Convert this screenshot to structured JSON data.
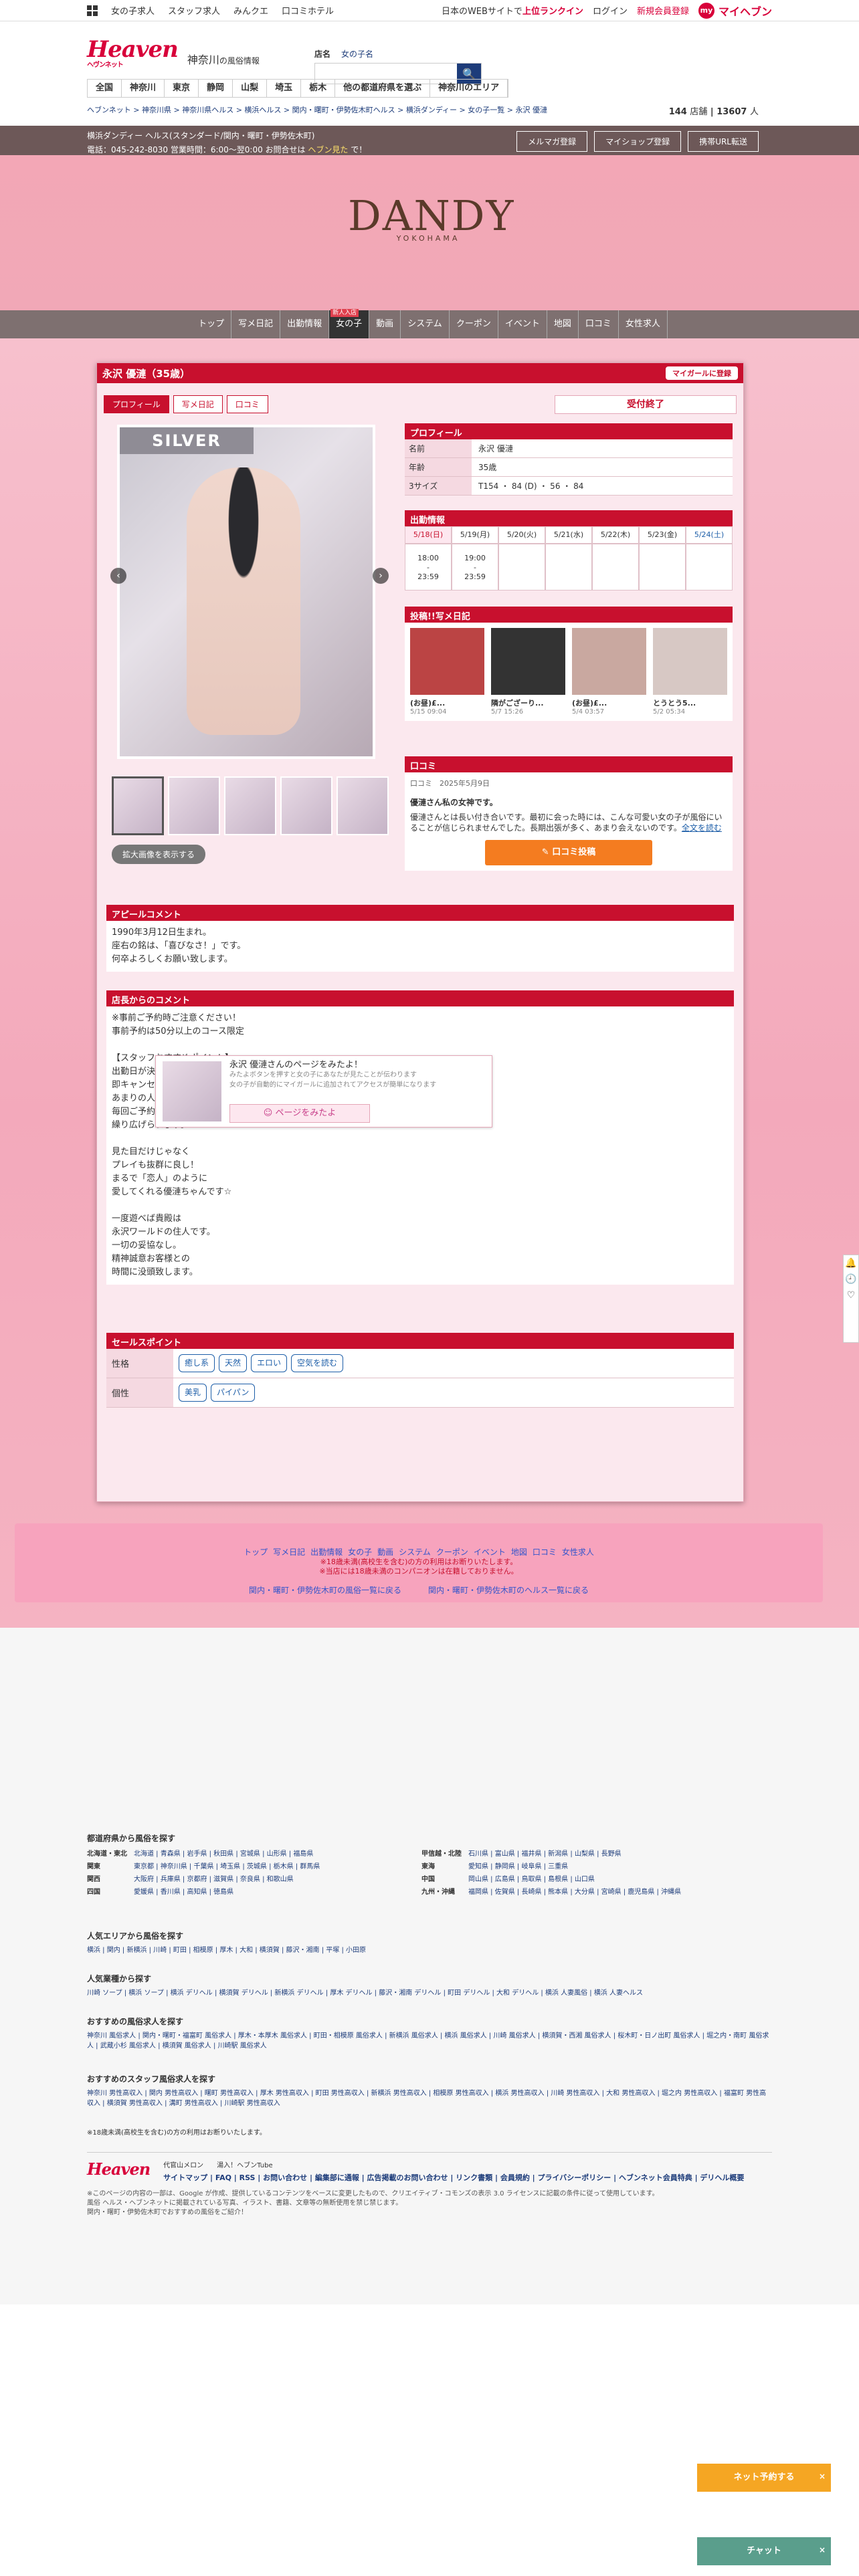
{
  "topbar": {
    "left": [
      "女の子求人",
      "スタッフ求人",
      "みんクエ",
      "口コミホテル"
    ],
    "right_text": "日本のWEBサイトで",
    "right_hl": "上位ランクイン",
    "login": "ログイン",
    "register": "新規会員登録",
    "myheaven": "マイヘブン"
  },
  "header": {
    "logo": "Heaven",
    "logo_sub": "ヘヴンネット",
    "region": "神奈川",
    "region_sub": "の風俗情報",
    "search_label": "店名",
    "search_ph": "女の子名"
  },
  "areanav": [
    "全国",
    "神奈川",
    "東京",
    "静岡",
    "山梨",
    "埼玉",
    "栃木",
    "他の都道府県を選ぶ",
    "神奈川のエリア"
  ],
  "breadcrumb": "ヘブンネット > 神奈川県 > 神奈川県ヘルス > 横浜ヘルス > 関内・曙町・伊勢佐木町ヘルス > 横浜ダンディー > 女の子一覧 > 永沢 優漣",
  "count": {
    "a": "144",
    "a_unit": "店舗",
    "b": "13607",
    "b_unit": "人"
  },
  "shopbar": {
    "line1": "横浜ダンディー ヘルス(スタンダード/関内・曙町・伊勢佐木町)",
    "line2": "電話：045-242-8030 営業時間：6:00〜翌0:00 お問合せは",
    "line2_hl": "ヘブン見た",
    "line2_end": "で！",
    "btn1": "メルマガ登録",
    "btn2": "マイショップ登録",
    "btn3": "携帯URL転送"
  },
  "shop_logo": {
    "mark": "DANDY",
    "sub": "YOKOHAMA"
  },
  "mainnav": [
    "トップ",
    "写メ日記",
    "出勤情報",
    "女の子",
    "動画",
    "システム",
    "クーポン",
    "イベント",
    "地図",
    "口コミ",
    "女性求人"
  ],
  "mainnav_badge": "新人入店",
  "profile": {
    "name": "永沢 優漣（35歳）",
    "mypage": "マイガールに登録",
    "tabs": [
      "プロフィール",
      "写メ日記",
      "口コミ"
    ],
    "status": "受付終了",
    "silver": "SILVER",
    "zoom": "拡大画像を表示する"
  },
  "prof_section": {
    "title": "プロフィール",
    "rows": [
      {
        "k": "名前",
        "v": "永沢 優漣"
      },
      {
        "k": "年齢",
        "v": "35歳"
      },
      {
        "k": "3サイズ",
        "v": "T154 ・ 84 (D) ・ 56 ・ 84"
      }
    ]
  },
  "sched": {
    "title": "出勤情報",
    "days": [
      "5/18(日)",
      "5/19(月)",
      "5/20(火)",
      "5/21(水)",
      "5/22(木)",
      "5/23(金)",
      "5/24(土)"
    ],
    "times": [
      "18:00\n-\n23:59",
      "19:00\n-\n23:59",
      "",
      "",
      "",
      "",
      ""
    ]
  },
  "diary": {
    "title": "投稿!!写メ日記",
    "items": [
      {
        "t": "(お昼)£...",
        "d": "5/15 09:04"
      },
      {
        "t": "隣がござーり...",
        "d": "5/7 15:26"
      },
      {
        "t": "(お昼)£...",
        "d": "5/4 03:57"
      },
      {
        "t": "とうとう5...",
        "d": "5/2 05:34"
      }
    ]
  },
  "review": {
    "title": "口コミ",
    "label": "口コミ",
    "date": "2025年5月9日",
    "heading": "優漣さん私の女神です。",
    "body": "優漣さんとは長い付き合いです。最初に会った時には、こんな可愛い女の子が風俗にいることが信じられませんでした。長期出張が多く、あまり会えないのです。",
    "more": "全文を読む",
    "btn": "✎ 口コミ投稿"
  },
  "appeal": {
    "title": "アピールコメント",
    "lines": [
      "1990年3月12日生まれ。",
      "座右の銘は、「喜びなさ！」です。",
      "何卒よろしくお願い致します。"
    ]
  },
  "manager": {
    "title": "店長からのコメント",
    "lines": [
      "※事前ご予約時ご注意ください！",
      "事前予約は50分以上のコース限定",
      "",
      "【スタッフおすすめポイント】",
      "出勤日が決まれば",
      "即キャンセル待ちになる女の子♪",
      "あまりの人気ぶりに",
      "毎回ご予約争奪戦が",
      "繰り広げられます。",
      "",
      "見た目だけじゃなく",
      "プレイも抜群に良し！",
      "まるで「恋人」のように",
      "愛してくれる優漣ちゃんです☆",
      "",
      "一度遊べば貴殿は",
      "永沢ワールドの住人です。",
      "一切の妥協なし。",
      "精神誠意お客様との",
      "時間に没頭致します。"
    ]
  },
  "sales": {
    "title": "セールスポイント",
    "rows": [
      {
        "k": "性格",
        "tags": [
          "癒し系",
          "天然",
          "エロい",
          "空気を読む"
        ]
      },
      {
        "k": "個性",
        "tags": [
          "美乳",
          "パイパン"
        ]
      }
    ]
  },
  "like": {
    "l1": "永沢 優漣さんのページをみたよ！",
    "l2": "みたよボタンを押すと女の子にあなたが見たことが伝わります",
    "l3": "女の子が自動的にマイガールに追加されてアクセスが簡単になります",
    "btn": "☺ ページをみたよ"
  },
  "footnav": {
    "links": [
      "トップ",
      "写メ日記",
      "出勤情報",
      "女の子",
      "動画",
      "システム",
      "クーポン",
      "イベント",
      "地図",
      "口コミ",
      "女性求人"
    ],
    "note1": "※18歳未満(高校生を含む)の方の利用はお断りいたします。",
    "note2": "※当店には18歳未満のコンパニオンは在籍しておりません。",
    "back1": "関内・曙町・伊勢佐木町の風俗一覧に戻る",
    "back2": "関内・曙町・伊勢佐木町のヘルス一覧に戻る"
  },
  "foot": {
    "pref_title": "都道府県から風俗を探す",
    "prefs": [
      {
        "k": "北海道・東北",
        "v": "北海道 | 青森県 | 岩手県 | 秋田県 | 宮城県 | 山形県 | 福島県"
      },
      {
        "k": "関東",
        "v": "東京都 | 神奈川県 | 千葉県 | 埼玉県 | 茨城県 | 栃木県 | 群馬県"
      },
      {
        "k": "関西",
        "v": "大阪府 | 兵庫県 | 京都府 | 滋賀県 | 奈良県 | 和歌山県"
      },
      {
        "k": "四国",
        "v": "愛媛県 | 香川県 | 高知県 | 徳島県"
      }
    ],
    "prefs2": [
      {
        "k": "甲信越・北陸",
        "v": "石川県 | 富山県 | 福井県 | 新潟県 | 山梨県 | 長野県"
      },
      {
        "k": "東海",
        "v": "愛知県 | 静岡県 | 岐阜県 | 三重県"
      },
      {
        "k": "中国",
        "v": "岡山県 | 広島県 | 鳥取県 | 島根県 | 山口県"
      },
      {
        "k": "九州・沖縄",
        "v": "福岡県 | 佐賀県 | 長崎県 | 熊本県 | 大分県 | 宮崎県 | 鹿児島県 | 沖縄県"
      }
    ],
    "area_title": "人気エリアから風俗を探す",
    "area": "横浜 | 関内 | 新横浜 | 川崎 | 町田 | 相模原 | 厚木 | 大和 | 横須賀 | 藤沢・湘南 | 平塚 | 小田原",
    "cat_title": "人気業種から探す",
    "cat": "川崎 ソープ | 横浜 ソープ | 横浜 デリヘル | 横須賀 デリヘル | 新横浜 デリヘル | 厚木 デリヘル | 藤沢・湘南 デリヘル | 町田 デリヘル | 大和 デリヘル | 横浜 人妻風俗 | 横浜 人妻ヘルス",
    "staff_title": "おすすめの風俗求人を探す",
    "staff": "神奈川 風俗求人 | 関内・曙町・福富町 風俗求人 | 厚木・本厚木 風俗求人 | 町田・相模原 風俗求人 | 新横浜 風俗求人 | 横浜 風俗求人 | 川崎 風俗求人 | 横須賀・西湘 風俗求人 | 桜木町・日ノ出町 風俗求人 | 堀之内・南町 風俗求人 | 武蔵小杉 風俗求人 | 横須賀 風俗求人 | 川崎駅 風俗求人",
    "male_title": "おすすめのスタッフ風俗求人を探す",
    "male": "神奈川 男性高収入 | 関内 男性高収入 | 曙町 男性高収入 | 厚木 男性高収入 | 町田 男性高収入 | 新横浜 男性高収入 | 相模原 男性高収入 | 横浜 男性高収入 | 川崎 男性高収入 | 大和 男性高収入 | 堀之内 男性高収入 | 福富町 男性高収入 | 横須賀 男性高収入 | 溝町 男性高収入 | 川崎駅 男性高収入",
    "notice": "※18歳未満(高校生を含む)の方の利用はお断りいたします。",
    "logo": "Heaven",
    "links1": "代官山メロン",
    "links2": "湯入！ヘブンTube",
    "sitemap": "サイトマップ | FAQ | RSS | お問い合わせ | 編集部に通報 | 広告掲載のお問い合わせ | リンク書類 | 会員規約 | プライバシーポリシー | ヘブンネット会員特典 | デリヘル概要",
    "copy": "※このページの内容の一部は、Google が作成、提供しているコンテンツをベースに変更したもので、クリエイティブ・コモンズの表示 3.0 ライセンスに記載の条件に従って使用しています。",
    "copy2": "風俗 ヘルス・ヘブンネットに掲載されている写真、イラスト、書籍、文章等の無断使用を禁じ禁じます。",
    "copy3": "関内・曙町・伊勢佐木町でおすすめの風俗をご紹介！"
  },
  "float": {
    "f1": "ネット予約する",
    "f2": "チャット"
  }
}
